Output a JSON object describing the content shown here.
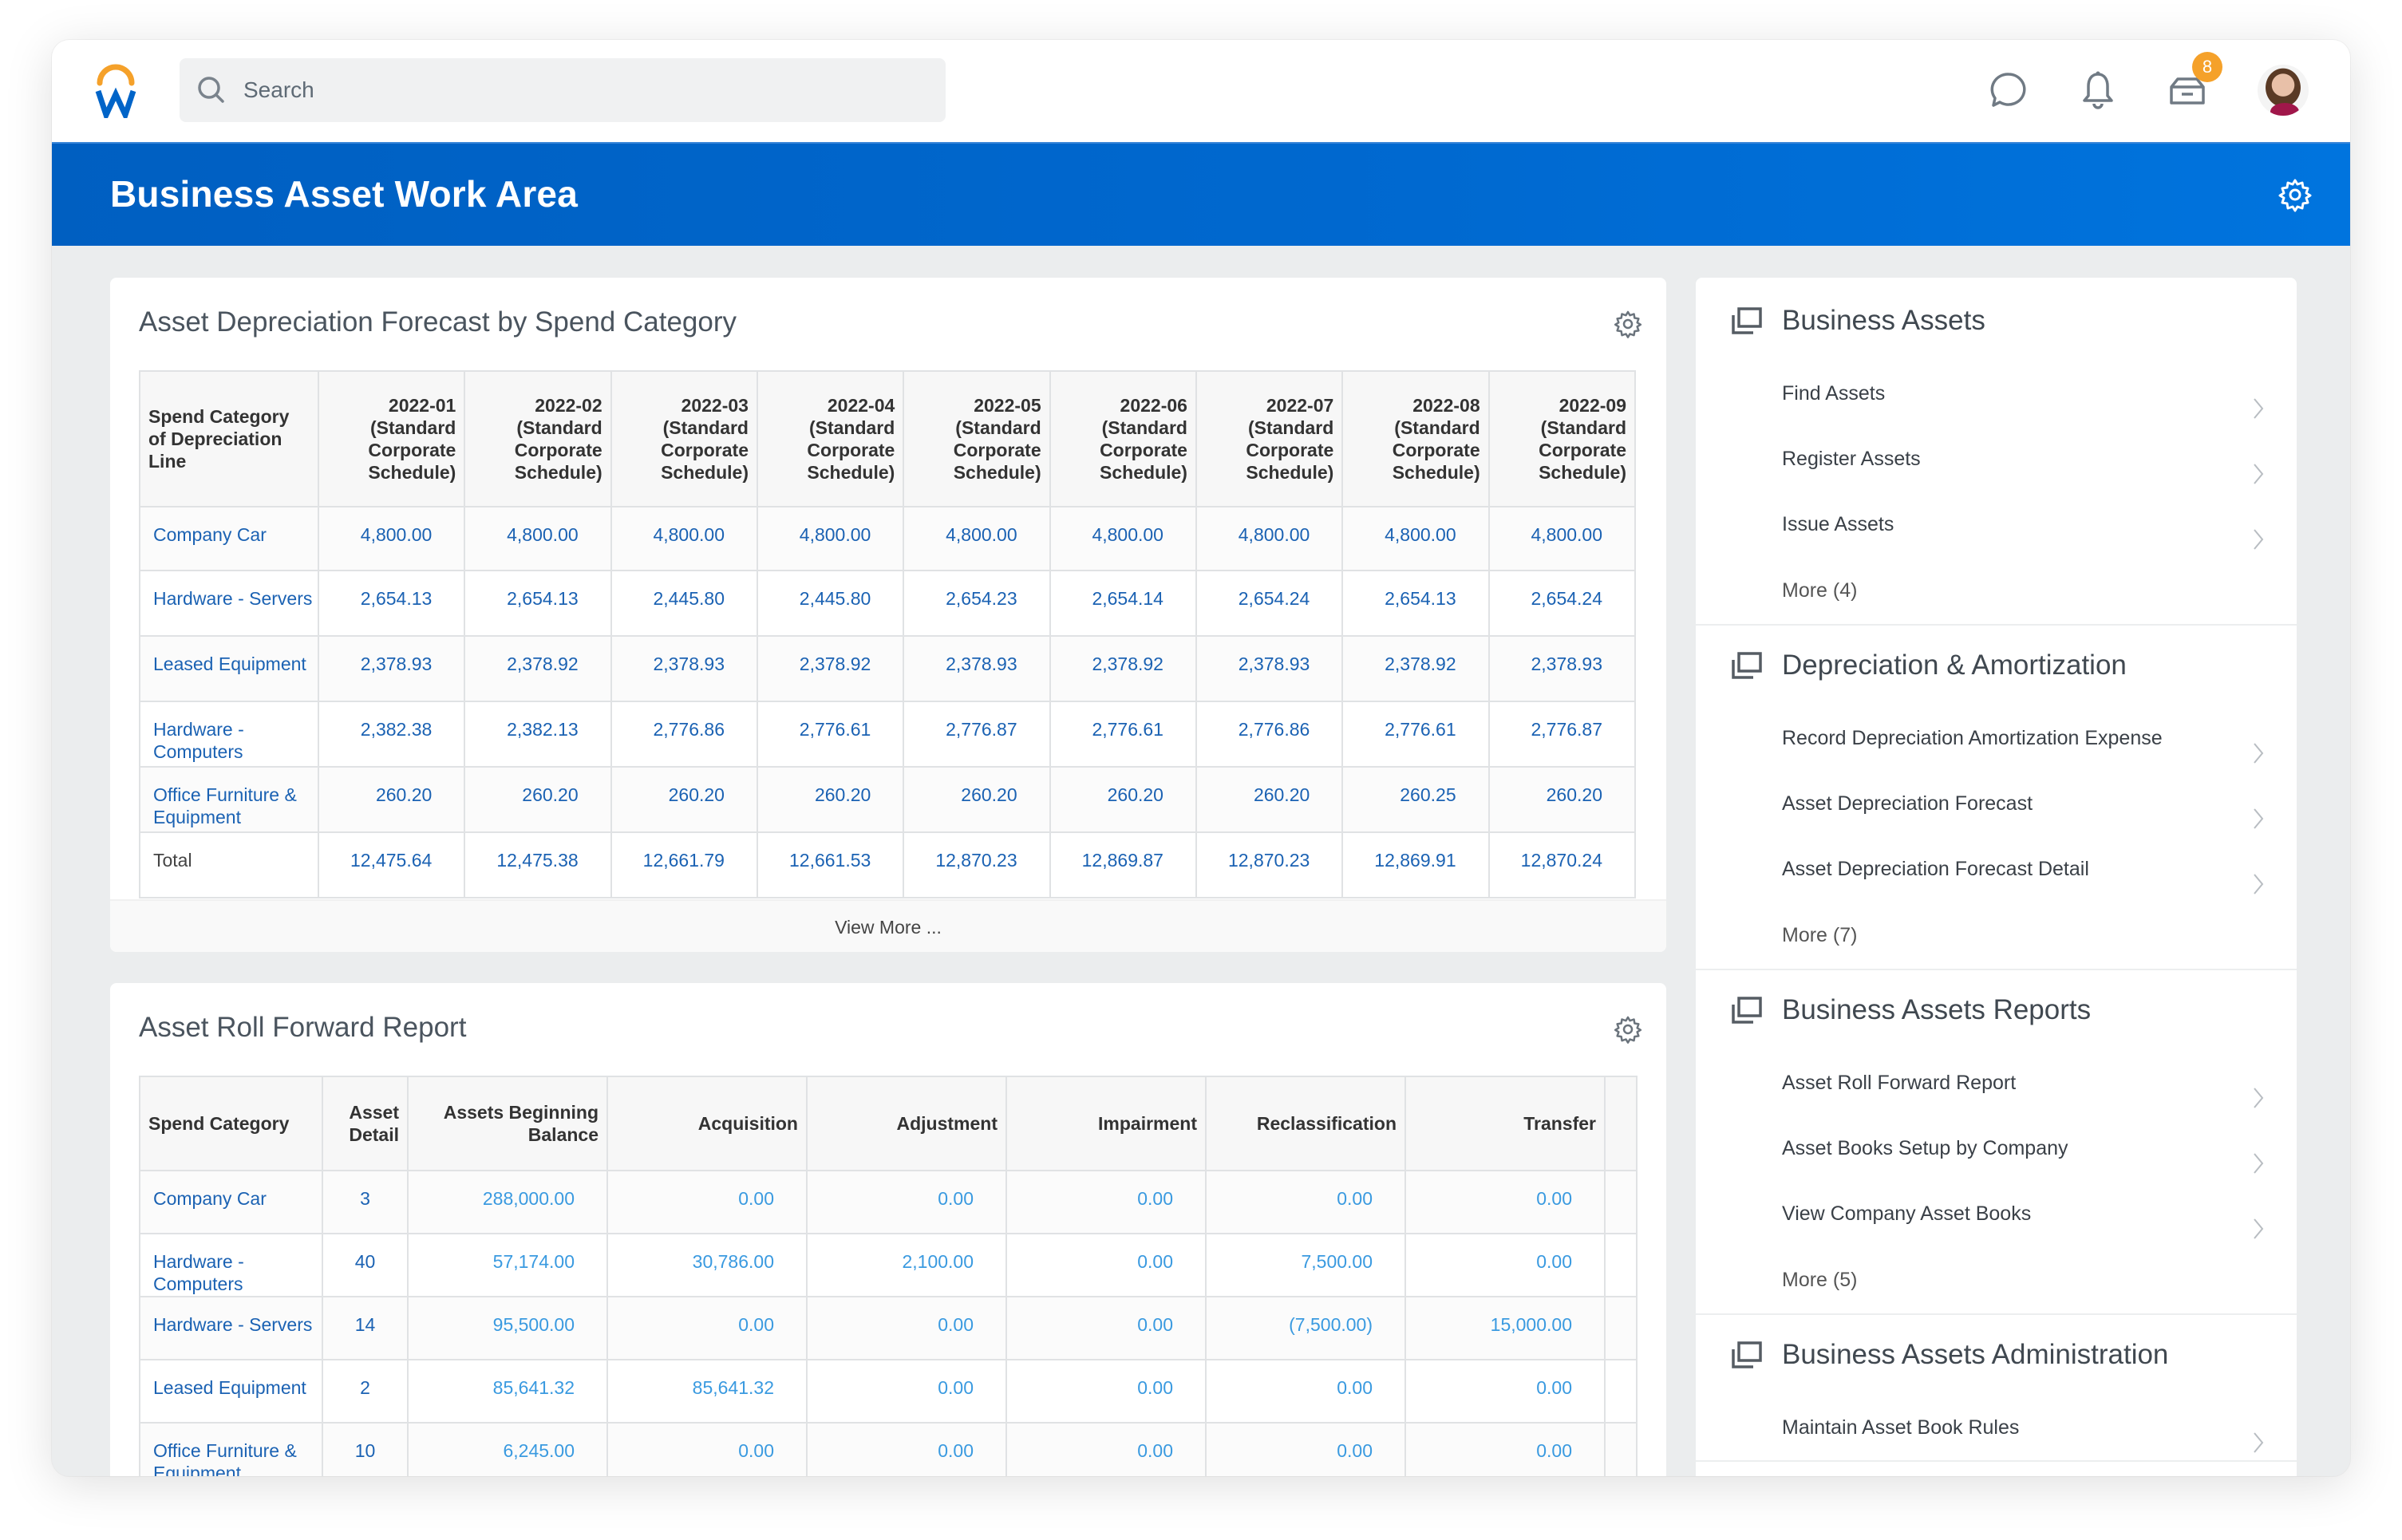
{
  "topbar": {
    "search_placeholder": "Search",
    "inbox_badge": "8",
    "icons": [
      "chat-icon",
      "bell-icon",
      "inbox-icon"
    ]
  },
  "banner": {
    "title": "Business Asset Work Area"
  },
  "colors": {
    "brand_blue": "#0069d0",
    "logo_orange": "#f5a12a",
    "link_dark_blue": "#1b62b3",
    "link_light_blue": "#3a9ae0",
    "badge_orange": "#f5a12a"
  },
  "depreciation_card": {
    "title": "Asset Depreciation Forecast by Spend Category",
    "view_more": "View More ...",
    "header_first": "Spend Category of Depreciation Line",
    "period_suffix": "(Standard Corporate Schedule)",
    "periods": [
      "2022-01",
      "2022-02",
      "2022-03",
      "2022-04",
      "2022-05",
      "2022-06",
      "2022-07",
      "2022-08",
      "2022-09"
    ],
    "rows": [
      {
        "category": "Company Car",
        "values": [
          "4,800.00",
          "4,800.00",
          "4,800.00",
          "4,800.00",
          "4,800.00",
          "4,800.00",
          "4,800.00",
          "4,800.00",
          "4,800.00"
        ]
      },
      {
        "category": "Hardware - Servers",
        "values": [
          "2,654.13",
          "2,654.13",
          "2,445.80",
          "2,445.80",
          "2,654.23",
          "2,654.14",
          "2,654.24",
          "2,654.13",
          "2,654.24"
        ]
      },
      {
        "category": "Leased Equipment",
        "values": [
          "2,378.93",
          "2,378.92",
          "2,378.93",
          "2,378.92",
          "2,378.93",
          "2,378.92",
          "2,378.93",
          "2,378.92",
          "2,378.93"
        ]
      },
      {
        "category": "Hardware - Computers",
        "values": [
          "2,382.38",
          "2,382.13",
          "2,776.86",
          "2,776.61",
          "2,776.87",
          "2,776.61",
          "2,776.86",
          "2,776.61",
          "2,776.87"
        ]
      },
      {
        "category": "Office Furniture & Equipment",
        "values": [
          "260.20",
          "260.20",
          "260.20",
          "260.20",
          "260.20",
          "260.20",
          "260.20",
          "260.25",
          "260.20"
        ]
      }
    ],
    "total": {
      "label": "Total",
      "values": [
        "12,475.64",
        "12,475.38",
        "12,661.79",
        "12,661.53",
        "12,870.23",
        "12,869.87",
        "12,870.23",
        "12,869.91",
        "12,870.24"
      ]
    }
  },
  "rollforward_card": {
    "title": "Asset Roll Forward Report",
    "headers": [
      "Spend Category",
      "Asset Detail",
      "Assets Beginning Balance",
      "Acquisition",
      "Adjustment",
      "Impairment",
      "Reclassification",
      "Transfer"
    ],
    "rows": [
      {
        "category": "Company Car",
        "detail": "3",
        "values": [
          "288,000.00",
          "0.00",
          "0.00",
          "0.00",
          "0.00",
          "0.00"
        ]
      },
      {
        "category": "Hardware - Computers",
        "detail": "40",
        "values": [
          "57,174.00",
          "30,786.00",
          "2,100.00",
          "0.00",
          "7,500.00",
          "0.00"
        ]
      },
      {
        "category": "Hardware - Servers",
        "detail": "14",
        "values": [
          "95,500.00",
          "0.00",
          "0.00",
          "0.00",
          "(7,500.00)",
          "15,000.00"
        ]
      },
      {
        "category": "Leased Equipment",
        "detail": "2",
        "values": [
          "85,641.32",
          "85,641.32",
          "0.00",
          "0.00",
          "0.00",
          "0.00"
        ]
      },
      {
        "category": "Office Furniture & Equipment",
        "detail": "10",
        "values": [
          "6,245.00",
          "0.00",
          "0.00",
          "0.00",
          "0.00",
          "0.00"
        ]
      }
    ]
  },
  "sidebar": {
    "sections": [
      {
        "title": "Business Assets",
        "items": [
          "Find Assets",
          "Register Assets",
          "Issue Assets"
        ],
        "more": "More (4)"
      },
      {
        "title": "Depreciation & Amortization",
        "items": [
          "Record Depreciation Amortization Expense",
          "Asset Depreciation Forecast",
          "Asset Depreciation Forecast Detail"
        ],
        "more": "More (7)"
      },
      {
        "title": "Business Assets Reports",
        "items": [
          "Asset Roll Forward Report",
          "Asset Books Setup by Company",
          "View Company Asset Books"
        ],
        "more": "More (5)"
      },
      {
        "title": "Business Assets Administration",
        "items": [
          "Maintain Asset Book Rules"
        ],
        "more": null
      }
    ]
  }
}
